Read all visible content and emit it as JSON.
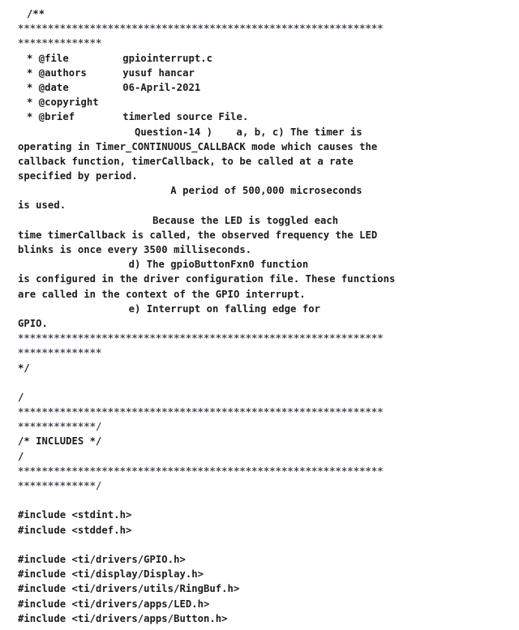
{
  "document": {
    "kind": "source-code-listing",
    "language": "c",
    "file_name": "gpiointerrupt.c",
    "background_color": "#ffffff",
    "text_color": "#1b1b1b",
    "star_color": "#4a4a5a"
  },
  "header_doc": {
    "open": "/**",
    "star_rule_part_1": "*************************************************************",
    "star_rule_part_2": "**************",
    "tags": [
      {
        "marker": "*",
        "tag": "@file",
        "value": "gpiointerrupt.c"
      },
      {
        "marker": "*",
        "tag": "@authors",
        "value": "yusuf hancar"
      },
      {
        "marker": "*",
        "tag": "@date",
        "value": "06-April-2021"
      },
      {
        "marker": "*",
        "tag": "@copyright",
        "value": ""
      },
      {
        "marker": "*",
        "tag": "@brief",
        "value": "timerled source File."
      }
    ],
    "close": "*/"
  },
  "includes_banner": {
    "slash": "/",
    "star_rule_part_1": "*************************************************************",
    "star_rule_part_2": "*************/",
    "title": "/* INCLUDES */"
  },
  "includes": [
    "#include <stdint.h>",
    "#include <stddef.h>",
    "#include <ti/drivers/GPIO.h>",
    "#include <ti/display/Display.h>",
    "#include <ti/drivers/utils/RingBuf.h>",
    "#include <ti/drivers/apps/LED.h>",
    "#include <ti/drivers/apps/Button.h>"
  ],
  "lines": [
    {
      "id": "l01",
      "text": "/**",
      "indent": 1
    },
    {
      "id": "l02",
      "text": "*************************************************************",
      "indent": 0,
      "stars": true
    },
    {
      "id": "l03",
      "text": "**************",
      "indent": 0,
      "stars": true
    },
    {
      "id": "l04",
      "text": "* @file         gpiointerrupt.c",
      "indent": 1
    },
    {
      "id": "l05",
      "text": "* @authors      yusuf hancar",
      "indent": 1
    },
    {
      "id": "l06",
      "text": "* @date         06-April-2021",
      "indent": 1
    },
    {
      "id": "l07",
      "text": "* @copyright",
      "indent": 1
    },
    {
      "id": "l08",
      "text": "* @brief        timerled source File.",
      "indent": 1
    },
    {
      "id": "l09",
      "text": "                  Question-14 )    a, b, c) The timer is",
      "indent": 1
    },
    {
      "id": "l10",
      "text": "operating in Timer_CONTINUOUS_CALLBACK mode which causes the",
      "indent": 0
    },
    {
      "id": "l11",
      "text": "callback function, timerCallback, to be called at a rate",
      "indent": 0
    },
    {
      "id": "l12",
      "text": "specified by period.",
      "indent": 0
    },
    {
      "id": "l13",
      "text": "                        A period of 500,000 microseconds",
      "indent": 1
    },
    {
      "id": "l14",
      "text": "is used.",
      "indent": 0
    },
    {
      "id": "l15",
      "text": "                     Because the LED is toggled each",
      "indent": 1
    },
    {
      "id": "l16",
      "text": "time timerCallback is called, the observed frequency the LED",
      "indent": 0
    },
    {
      "id": "l17",
      "text": "blinks is once every 3500 milliseconds.",
      "indent": 0
    },
    {
      "id": "l18",
      "text": "                 d) The gpioButtonFxn0 function",
      "indent": 1
    },
    {
      "id": "l19",
      "text": "is configured in the driver configuration file. These functions",
      "indent": 0
    },
    {
      "id": "l20",
      "text": "are called in the context of the GPIO interrupt.",
      "indent": 0
    },
    {
      "id": "l21",
      "text": "                 e) Interrupt on falling edge for",
      "indent": 1
    },
    {
      "id": "l22",
      "text": "GPIO.",
      "indent": 0
    },
    {
      "id": "l23",
      "text": "*************************************************************",
      "indent": 0,
      "stars": true
    },
    {
      "id": "l24",
      "text": "**************",
      "indent": 0,
      "stars": true
    },
    {
      "id": "l25",
      "text": "*/",
      "indent": 0
    },
    {
      "id": "l26",
      "text": "",
      "indent": 0,
      "blank": true
    },
    {
      "id": "l27",
      "text": "/",
      "indent": 0
    },
    {
      "id": "l28",
      "text": "*************************************************************",
      "indent": 0,
      "stars": true
    },
    {
      "id": "l29",
      "text": "*************/",
      "indent": 0,
      "stars": true
    },
    {
      "id": "l30",
      "text": "/* INCLUDES */",
      "indent": 0
    },
    {
      "id": "l31",
      "text": "/",
      "indent": 0
    },
    {
      "id": "l32",
      "text": "*************************************************************",
      "indent": 0,
      "stars": true
    },
    {
      "id": "l33",
      "text": "*************/",
      "indent": 0,
      "stars": true
    },
    {
      "id": "l34",
      "text": "",
      "indent": 0,
      "blank": true
    },
    {
      "id": "l35",
      "text": "#include <stdint.h>",
      "indent": 0
    },
    {
      "id": "l36",
      "text": "#include <stddef.h>",
      "indent": 0
    },
    {
      "id": "l37",
      "text": "",
      "indent": 0,
      "blank": true
    },
    {
      "id": "l38",
      "text": "#include <ti/drivers/GPIO.h>",
      "indent": 0
    },
    {
      "id": "l39",
      "text": "#include <ti/display/Display.h>",
      "indent": 0
    },
    {
      "id": "l40",
      "text": "#include <ti/drivers/utils/RingBuf.h>",
      "indent": 0
    },
    {
      "id": "l41",
      "text": "#include <ti/drivers/apps/LED.h>",
      "indent": 0
    },
    {
      "id": "l42",
      "text": "#include <ti/drivers/apps/Button.h>",
      "indent": 0
    }
  ]
}
